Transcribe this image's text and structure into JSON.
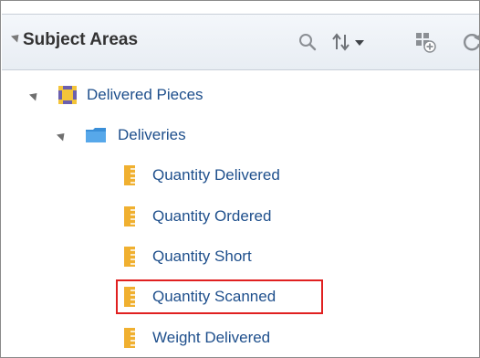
{
  "panel": {
    "title": "Subject Areas",
    "toolbar": {
      "search": "search-icon",
      "sort": "sort-icon",
      "grid": "add-grid-icon",
      "refresh": "refresh-icon"
    }
  },
  "tree": {
    "subject_area": {
      "label": "Delivered Pieces",
      "icon": "subject-area-icon"
    },
    "folder": {
      "label": "Deliveries",
      "icon": "folder-icon"
    },
    "measures": [
      {
        "label": "Quantity Delivered",
        "icon": "measure-icon"
      },
      {
        "label": "Quantity Ordered",
        "icon": "measure-icon"
      },
      {
        "label": "Quantity Short",
        "icon": "measure-icon"
      },
      {
        "label": "Quantity Scanned",
        "icon": "measure-icon",
        "highlighted": true
      },
      {
        "label": "Weight Delivered",
        "icon": "measure-icon"
      }
    ]
  },
  "colors": {
    "label": "#1e4f8c",
    "highlight": "#e02020",
    "measure_icon": "#f0b030",
    "folder_icon": "#3a8fd8"
  }
}
